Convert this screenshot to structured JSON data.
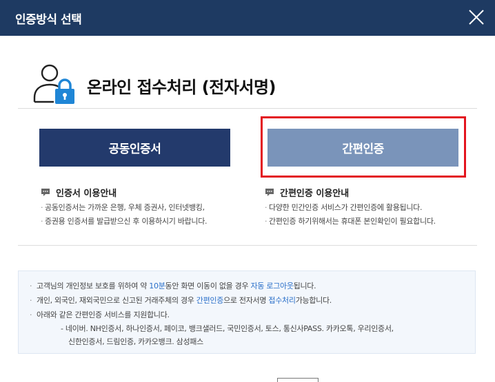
{
  "dialog": {
    "title": "인증방식 선택",
    "close_icon": "close-icon"
  },
  "heading": {
    "icon": "user-lock-icon",
    "text": "온라인 접수처리 (전자서명)"
  },
  "buttons": {
    "cert_label": "공동인증서",
    "simple_label": "간편인증",
    "highlighted": "simple"
  },
  "cert_info": {
    "icon": "speech-bubble-icon",
    "title": "인증서 이용안내",
    "lines": [
      "공동인증서는 가까운 은행, 우체 증권사, 인터넷뱅킹,",
      "증권용 인증서를 발급받으신 후 이용하시기 바랍니다."
    ]
  },
  "simple_info": {
    "icon": "speech-bubble-icon",
    "title": "간편인증 이용안내",
    "lines": [
      "다양한 민간인증 서비스가 간편인증에 활용됩니다.",
      "간편인증 하기위해서는 휴대폰 본인확인이 필요합니다."
    ]
  },
  "notice": {
    "l1_a": "고객님의 개인정보 보호를 위하여 약 ",
    "l1_b": "10분",
    "l1_c": "동안 화면 이동이 없을 경우 ",
    "l1_d": "자동 로그아웃",
    "l1_e": "됩니다.",
    "l2_a": "개인, 외국인, 재외국민으로 신고된 거래주체의 경우 ",
    "l2_b": "간편인증",
    "l2_c": "으로 전자서명 ",
    "l2_d": "접수처리",
    "l2_e": "가능합니다.",
    "l3": "아래와 같은 간편인증 서비스를 지원합니다.",
    "l4": "- 네이버. NH인증서, 하나인증서, 페이코, 뱅크샐러드, 국민인증서, 토스, 통신사PASS. 카카오톡, 우리인증서,",
    "l5": "신한인증서, 드림인증, 카카오뱅크. 삼성패스"
  },
  "colors": {
    "titlebar": "#1e3a62",
    "cert_button": "#233a6c",
    "simple_button": "#7a94ba",
    "highlight_border": "#e3141e",
    "link_text": "#2a6fc9",
    "notice_bg": "#f3f7fc"
  }
}
